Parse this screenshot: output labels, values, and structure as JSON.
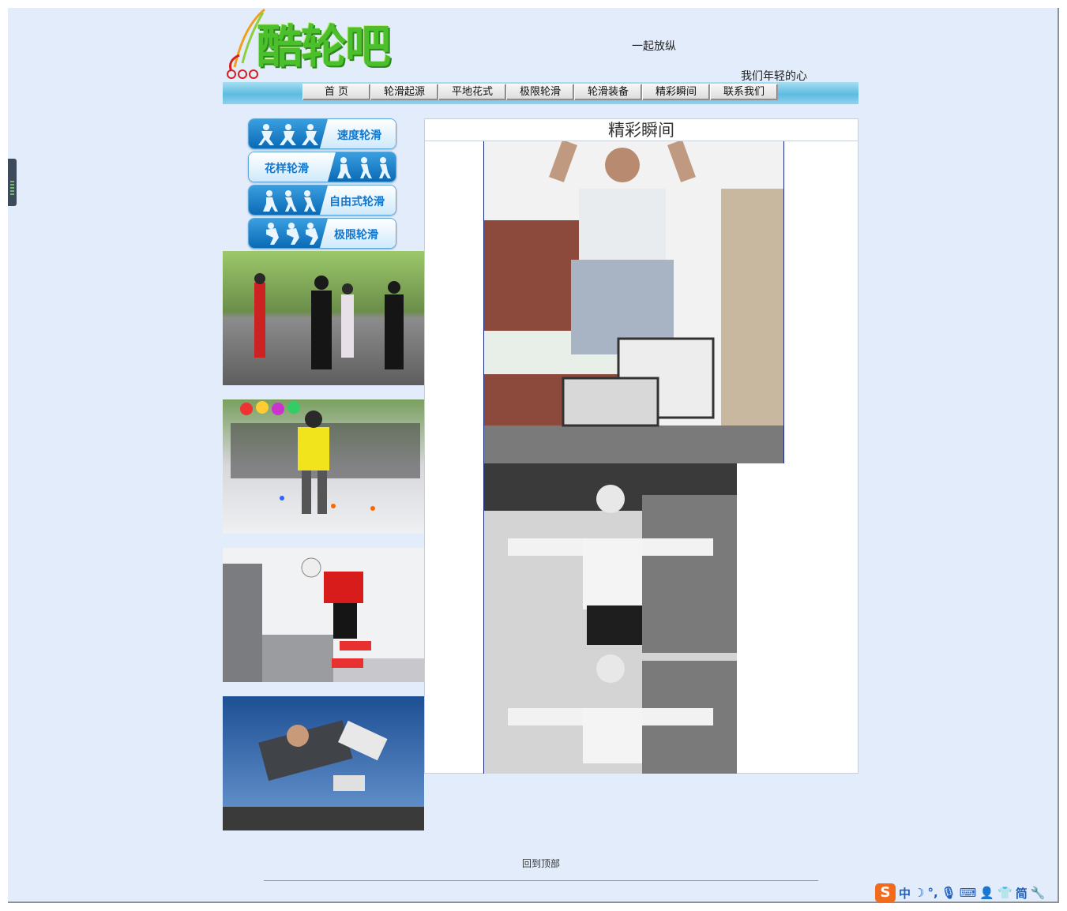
{
  "header": {
    "logo_text": "酷轮吧",
    "slogan_line1": "一起放纵",
    "slogan_line2": "我们年轻的心"
  },
  "nav": {
    "items": [
      "首 页",
      "轮滑起源",
      "平地花式",
      "极限轮滑",
      "轮滑装备",
      "精彩瞬间",
      "联系我们"
    ]
  },
  "categories": [
    {
      "label": "速度轮滑"
    },
    {
      "label": "花样轮滑"
    },
    {
      "label": "自由式轮滑"
    },
    {
      "label": "极限轮滑"
    }
  ],
  "main": {
    "title": "精彩瞬间"
  },
  "footer": {
    "back_to_top": "回到顶部"
  },
  "ime_toolbar": {
    "logo": "S",
    "mode": "中",
    "simplified": "简"
  }
}
